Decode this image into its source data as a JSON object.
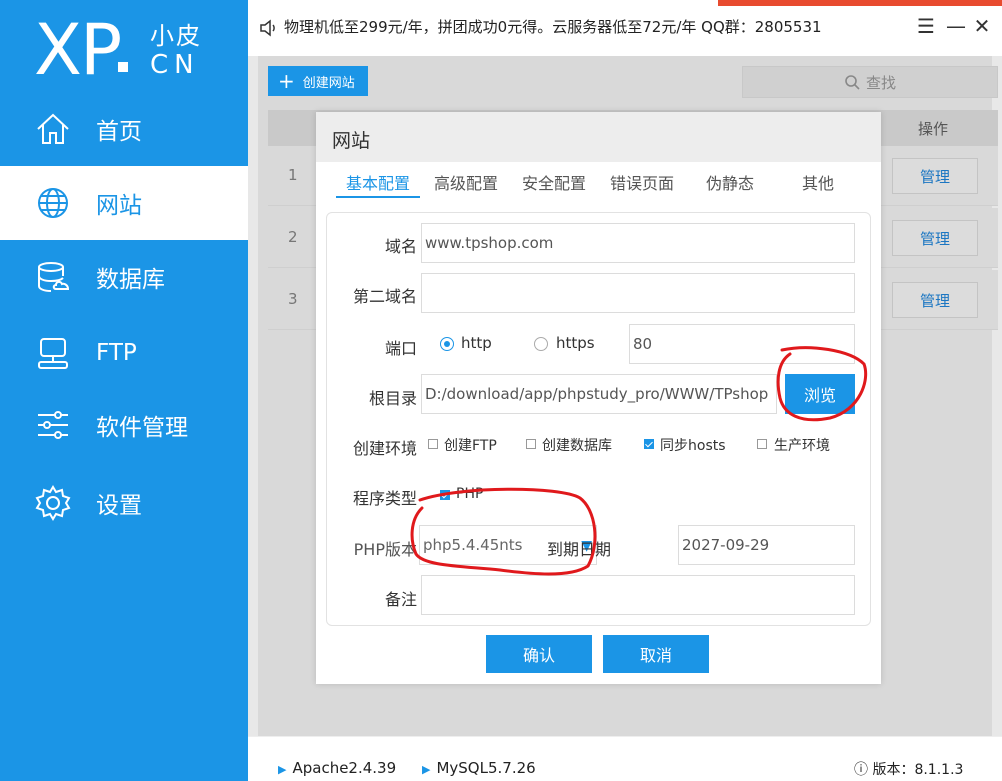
{
  "brand": {
    "logo_main": "XP",
    "logo_cn_top": "小皮",
    "logo_cn_bottom": "CN"
  },
  "sidebar": {
    "items": [
      {
        "label": "首页",
        "icon": "home-icon",
        "active": false
      },
      {
        "label": "网站",
        "icon": "globe-icon",
        "active": true
      },
      {
        "label": "数据库",
        "icon": "database-icon",
        "active": false
      },
      {
        "label": "FTP",
        "icon": "server-icon",
        "active": false
      },
      {
        "label": "软件管理",
        "icon": "sliders-icon",
        "active": false
      },
      {
        "label": "设置",
        "icon": "gear-icon",
        "active": false
      }
    ]
  },
  "topbar": {
    "notice": "物理机低至299元/年，拼团成功0元得。云服务器低至72元/年  QQ群：2805531"
  },
  "toolbar": {
    "create_label": "创建网站",
    "search_label": "查找"
  },
  "table": {
    "op_header": "操作",
    "rows": [
      {
        "num": "1",
        "action": "管理"
      },
      {
        "num": "2",
        "action": "管理"
      },
      {
        "num": "3",
        "action": "管理"
      }
    ]
  },
  "modal": {
    "title": "网站",
    "tabs": [
      "基本配置",
      "高级配置",
      "安全配置",
      "错误页面",
      "伪静态",
      "其他"
    ],
    "active_tab": "基本配置",
    "fields": {
      "domain_label": "域名",
      "domain_value": "www.tpshop.com",
      "second_domain_label": "第二域名",
      "second_domain_value": "",
      "port_label": "端口",
      "http_label": "http",
      "https_label": "https",
      "port_value": "80",
      "root_label": "根目录",
      "root_value": "D:/download/app/phpstudy_pro/WWW/TPshop",
      "browse_label": "浏览",
      "env_label": "创建环境",
      "env_options": [
        {
          "label": "创建FTP",
          "checked": false
        },
        {
          "label": "创建数据库",
          "checked": false
        },
        {
          "label": "同步hosts",
          "checked": true
        },
        {
          "label": "生产环境",
          "checked": false
        }
      ],
      "program_label": "程序类型",
      "program_option": "PHP",
      "php_label": "PHP版本",
      "php_value": "php5.4.45nts",
      "expire_label": "到期日期",
      "expire_value": "2027-09-29",
      "note_label": "备注",
      "note_value": ""
    },
    "confirm_label": "确认",
    "cancel_label": "取消"
  },
  "statusbar": {
    "apache": "Apache2.4.39",
    "mysql": "MySQL5.7.26",
    "version": "ⓘ 版本：8.1.1.3"
  },
  "colors": {
    "accent": "#1b95e6",
    "annotation": "#e0191c"
  }
}
